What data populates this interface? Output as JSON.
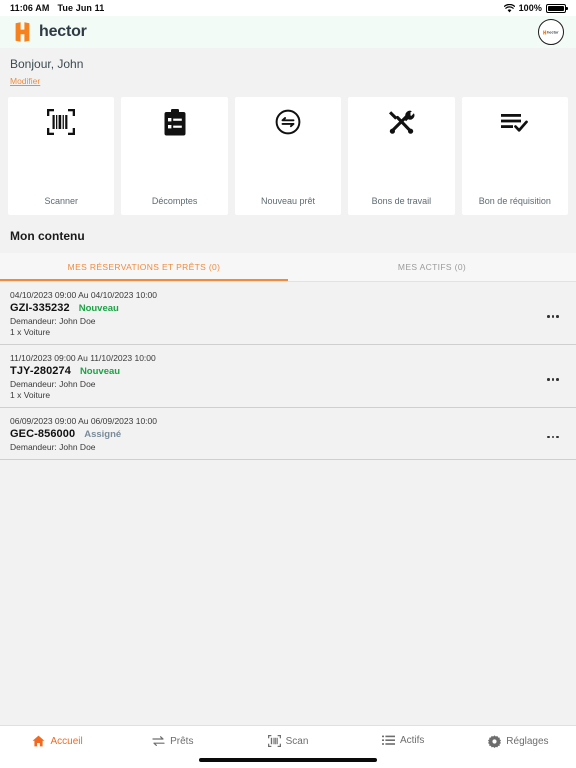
{
  "status_bar": {
    "time": "11:06 AM",
    "date": "Tue Jun 11",
    "battery_percent": "100%",
    "wifi_icon": "wifi-icon",
    "battery_icon": "battery-icon"
  },
  "header": {
    "brand": "hector",
    "logo_icon": "hector-h-logo-icon",
    "avatar_label": "hector",
    "avatar_icon": "user-avatar-icon",
    "background": "#f2fbf5"
  },
  "greeting": {
    "text": "Bonjour, John",
    "edit_link": "Modifier"
  },
  "shortcuts": [
    {
      "label": "Scanner",
      "icon": "barcode-scan-icon"
    },
    {
      "label": "Décomptes",
      "icon": "clipboard-list-icon"
    },
    {
      "label": "Nouveau prêt",
      "icon": "loan-exchange-icon"
    },
    {
      "label": "Bons de travail",
      "icon": "tools-icon"
    },
    {
      "label": "Bon de réquisition",
      "icon": "list-check-icon"
    }
  ],
  "content": {
    "title": "Mon contenu",
    "tabs": [
      {
        "label": "MES RÉSERVATIONS ET PRÊTS (0)",
        "active": true
      },
      {
        "label": "MES ACTIFS (0)",
        "active": false
      }
    ]
  },
  "list_items": [
    {
      "dates": "04/10/2023 09:00 Au 04/10/2023 10:00",
      "code": "GZI-335232",
      "status": "Nouveau",
      "status_color": "#1ba345",
      "requester": "Demandeur: John Doe",
      "quantity": "1 x Voiture",
      "menu_icon": "more-options-icon"
    },
    {
      "dates": "11/10/2023 09:00 Au 11/10/2023 10:00",
      "code": "TJY-280274",
      "status": "Nouveau",
      "status_color": "#1ba345",
      "requester": "Demandeur: John Doe",
      "quantity": "1 x Voiture",
      "menu_icon": "more-options-icon"
    },
    {
      "dates": "06/09/2023 09:00 Au 06/09/2023 10:00",
      "code": "GEC-856000",
      "status": "Assigné",
      "status_color": "#7a8b99",
      "requester": "Demandeur: John Doe",
      "quantity": "",
      "menu_icon": "more-options-icon"
    }
  ],
  "bottom_nav": [
    {
      "label": "Accueil",
      "icon": "home-icon",
      "active": true
    },
    {
      "label": "Prêts",
      "icon": "transfer-arrows-icon",
      "active": false
    },
    {
      "label": "Scan",
      "icon": "barcode-scan-icon",
      "active": false
    },
    {
      "label": "Actifs",
      "icon": "list-icon",
      "active": false
    },
    {
      "label": "Réglages",
      "icon": "gear-icon",
      "active": false
    }
  ],
  "colors": {
    "accent": "#f26a21",
    "link": "#ef8b3f",
    "page_bg": "#f2f2f2",
    "header_bg": "#f2fbf5"
  }
}
